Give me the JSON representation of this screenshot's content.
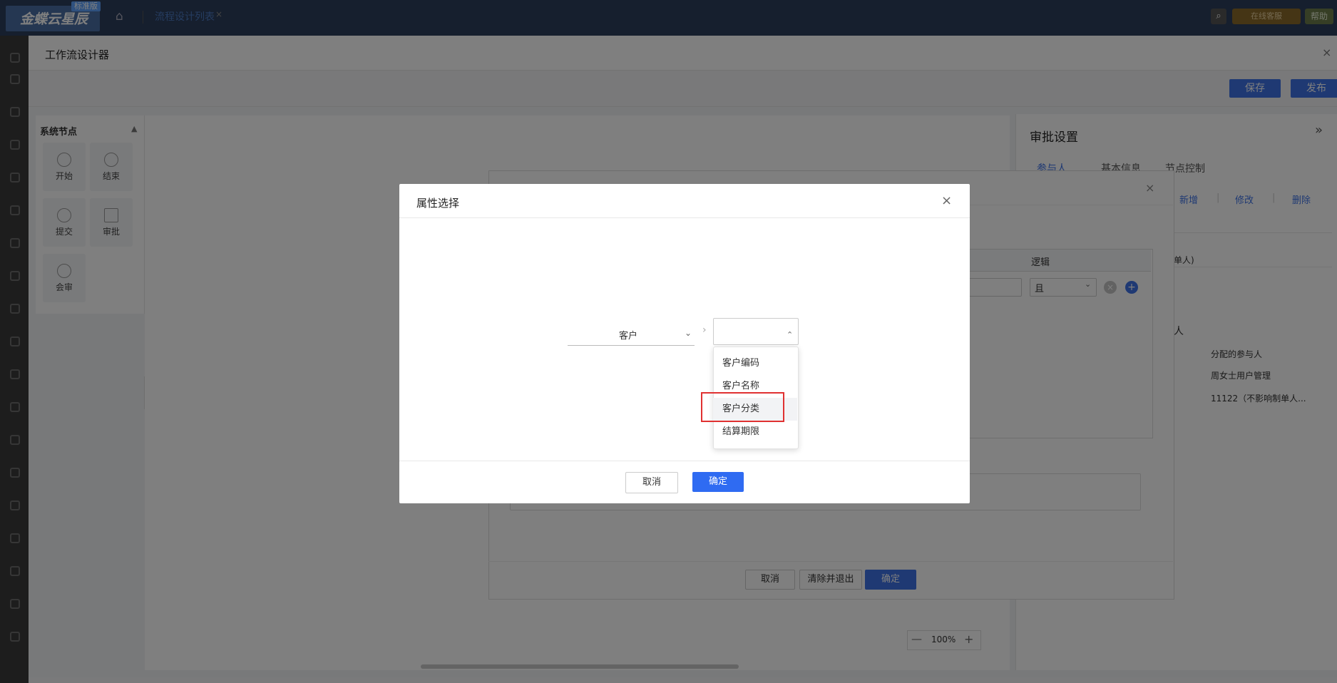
{
  "topbar": {
    "brand": "金蝶云星辰",
    "brand_badge": "标准版",
    "home_icon": "home-icon",
    "tab_label": "流程设计列表",
    "tab_close": "×",
    "search_icon": "search-icon",
    "service_label": "在线客服",
    "help_label": "帮助"
  },
  "designer": {
    "title": "工作流设计器",
    "close": "×",
    "save_label": "保存",
    "publish_label": "发布"
  },
  "nodes_panel": {
    "title": "系统节点",
    "collapse": "▲",
    "nodes": [
      {
        "label": "开始",
        "icon": "play-icon"
      },
      {
        "label": "结束",
        "icon": "stop-icon"
      },
      {
        "label": "提交",
        "icon": "user-icon"
      },
      {
        "label": "审批",
        "icon": "approve-icon"
      },
      {
        "label": "会审",
        "icon": "cloud-icon"
      }
    ],
    "side_tab": "〈"
  },
  "zoom": {
    "minus": "—",
    "value": "100%",
    "plus": "+"
  },
  "approval": {
    "title": "审批设置",
    "expand": "»",
    "tabs": [
      "参与人",
      "基本信息",
      "节点控制"
    ],
    "actions": [
      "新增",
      "修改",
      "删除"
    ],
    "pipe": "|",
    "row_text_1": "单人)",
    "section_label": "人",
    "col_header": "分配的参与人",
    "rows": [
      "周女士用户管理",
      "11122（不影响制单人..."
    ]
  },
  "condition_dialog": {
    "close": "×",
    "logic_header": "逻辑",
    "logic_value": "且",
    "delete_icon": "×",
    "add_icon": "+",
    "cancel_label": "取消",
    "clear_exit_label": "清除并退出",
    "confirm_label": "确定"
  },
  "property_dialog": {
    "title": "属性选择",
    "close": "×",
    "level1_value": "客户",
    "level1_arrow": "⌄",
    "separator": "›",
    "level2_arrow": "⌃",
    "options": [
      "客户编码",
      "客户名称",
      "客户分类",
      "结算期限"
    ],
    "cancel_label": "取消",
    "ok_label": "确定"
  }
}
